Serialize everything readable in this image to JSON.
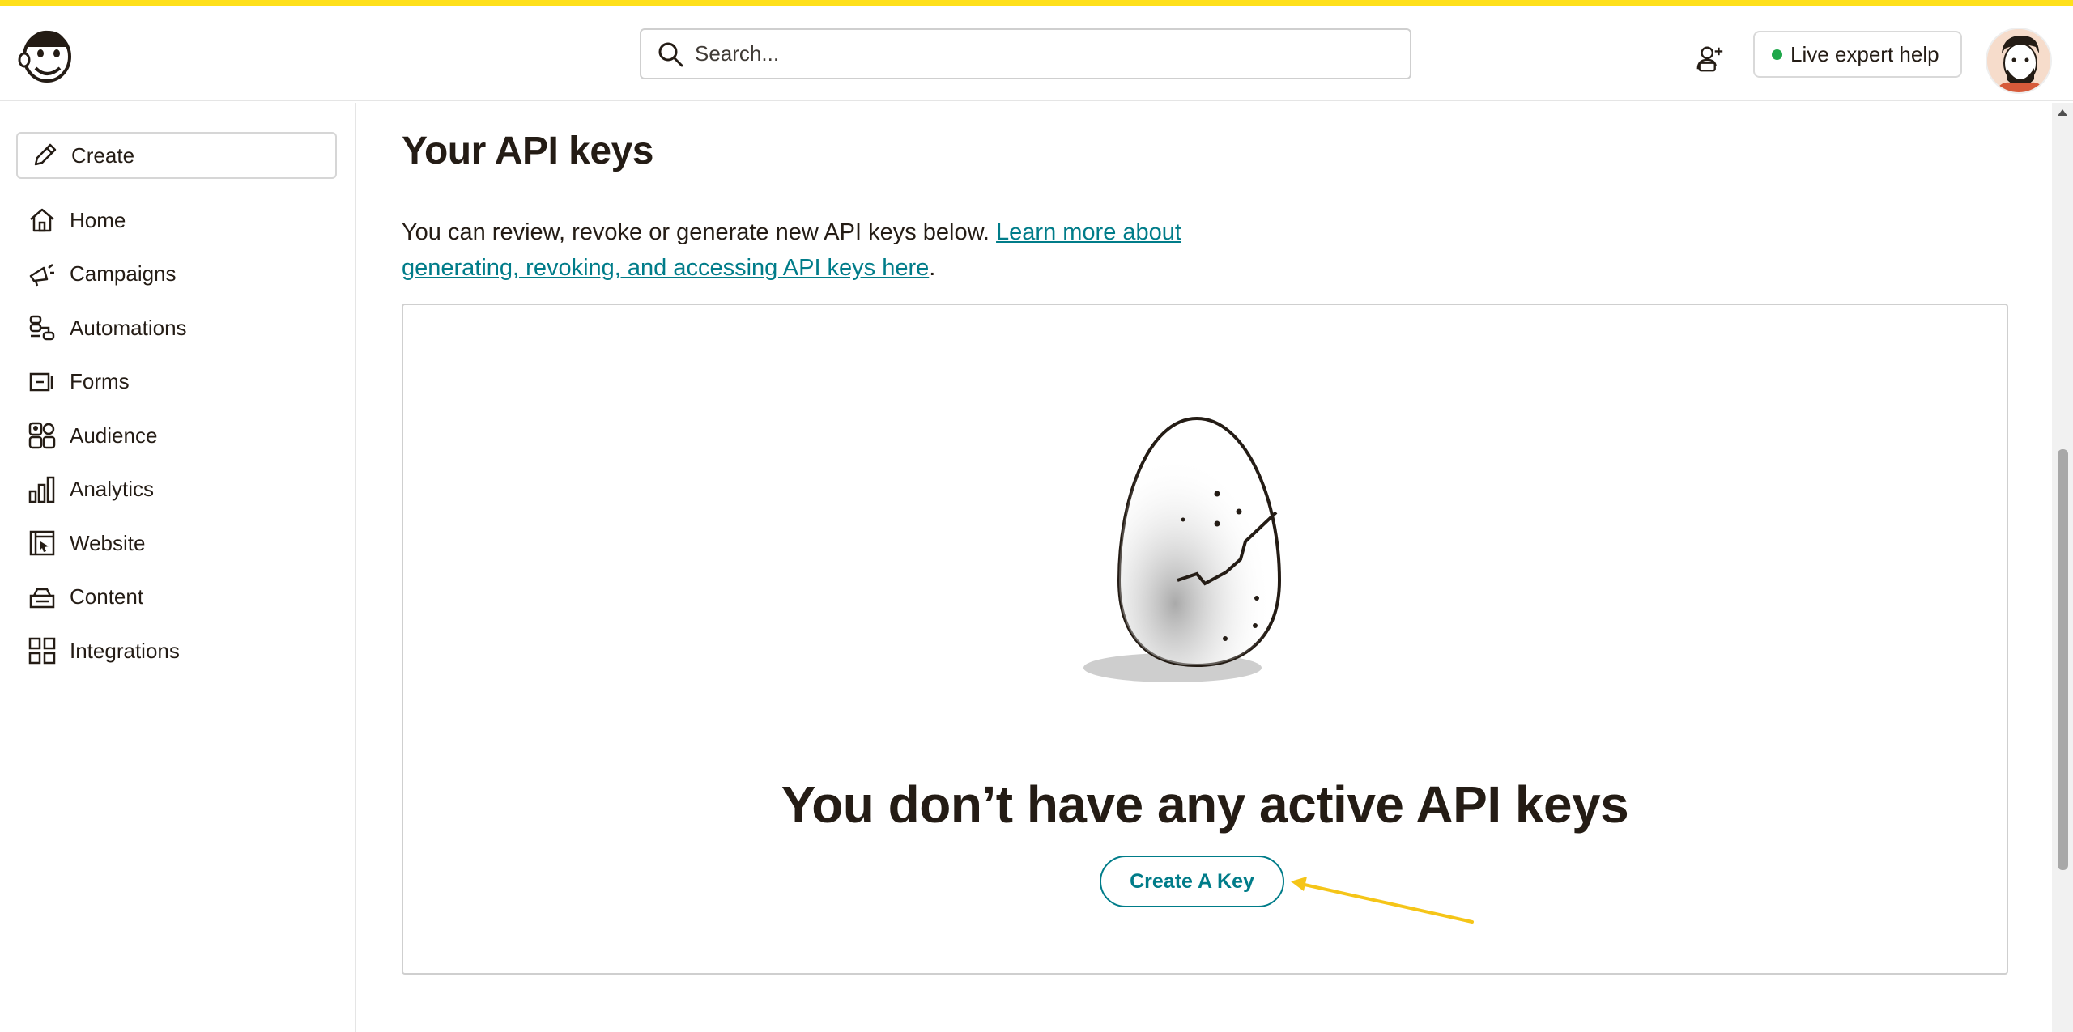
{
  "header": {
    "search_placeholder": "Search...",
    "expert_label": "Live expert help",
    "accent_color": "#ffe01b"
  },
  "sidebar": {
    "create_label": "Create",
    "items": [
      {
        "label": "Home",
        "icon": "home-icon"
      },
      {
        "label": "Campaigns",
        "icon": "megaphone-icon"
      },
      {
        "label": "Automations",
        "icon": "workflow-icon"
      },
      {
        "label": "Forms",
        "icon": "form-icon"
      },
      {
        "label": "Audience",
        "icon": "audience-icon"
      },
      {
        "label": "Analytics",
        "icon": "bar-chart-icon"
      },
      {
        "label": "Website",
        "icon": "website-icon"
      },
      {
        "label": "Content",
        "icon": "content-icon"
      },
      {
        "label": "Integrations",
        "icon": "grid-icon"
      }
    ]
  },
  "main": {
    "title": "Your API keys",
    "intro_text": "You can review, revoke or generate new API keys below. ",
    "intro_link": "Learn more about generating, revoking, and accessing API keys here",
    "intro_end": ".",
    "empty_title": "You don’t have any active API keys",
    "create_key_label": "Create A Key",
    "link_color": "#007c89"
  }
}
